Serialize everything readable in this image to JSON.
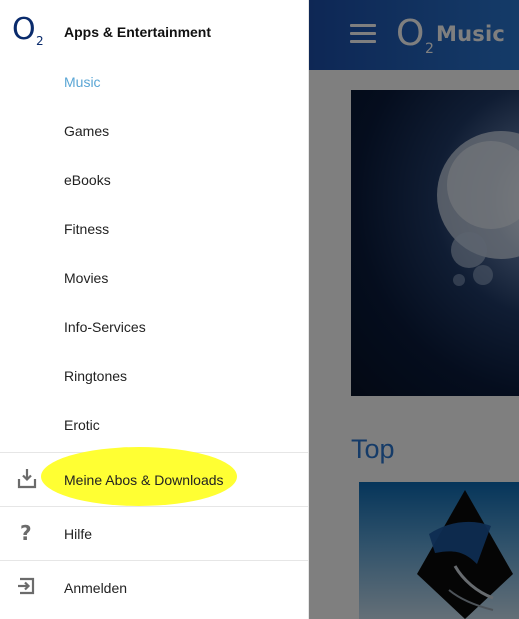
{
  "app": {
    "brand": {
      "o": "O",
      "two": "2",
      "name": "Music"
    },
    "section_title": "Top"
  },
  "drawer": {
    "logo": {
      "o": "O",
      "two": "2"
    },
    "title": "Apps & Entertainment",
    "subitems": [
      {
        "label": "Music",
        "active": true
      },
      {
        "label": "Games"
      },
      {
        "label": "eBooks"
      },
      {
        "label": "Fitness"
      },
      {
        "label": "Movies"
      },
      {
        "label": "Info-Services"
      },
      {
        "label": "Ringtones"
      },
      {
        "label": "Erotic"
      }
    ],
    "rows": {
      "downloads": {
        "label": "Meine Abos & Downloads",
        "icon": "download-tray-icon"
      },
      "help": {
        "label": "Hilfe",
        "icon": "question-mark-icon"
      },
      "login": {
        "label": "Anmelden",
        "icon": "login-arrow-icon"
      }
    }
  },
  "colors": {
    "active": "#5aa6d5",
    "highlight": "#ffff33",
    "header_gradient_start": "#0a2a73",
    "header_gradient_end": "#2a77d1"
  }
}
